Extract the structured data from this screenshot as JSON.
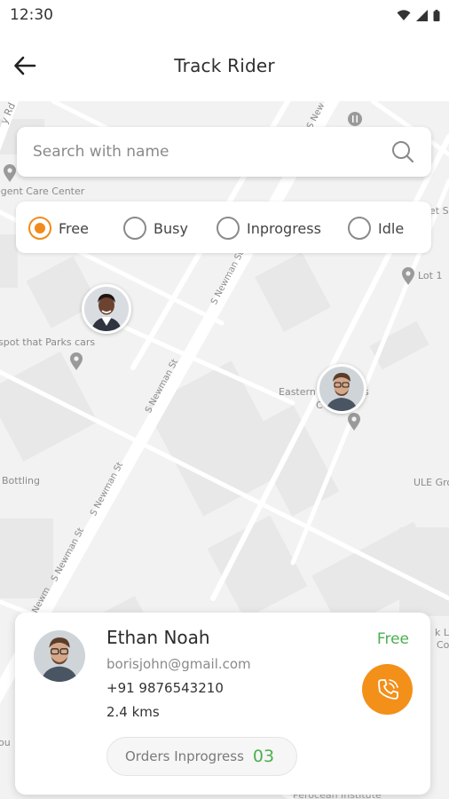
{
  "status_bar": {
    "time": "12:30"
  },
  "header": {
    "title": "Track Rider"
  },
  "search": {
    "placeholder": "Search with name"
  },
  "filters": [
    {
      "label": "Free",
      "selected": true
    },
    {
      "label": "Busy",
      "selected": false
    },
    {
      "label": "Inprogress",
      "selected": false
    },
    {
      "label": "Idle",
      "selected": false
    }
  ],
  "map": {
    "labels": {
      "rd": "y Rd",
      "care_center": "egent Care Center",
      "spot_parks": "spot that Parks cars",
      "eastern": "Eastern",
      "eastern_right": "s",
      "eastern_sub": "C",
      "bottling": "Bottling",
      "ule": "ULE Gro",
      "lot": "Lot 1",
      "st_right": "et S",
      "newman_1": "S Newman St",
      "newman_2": "S Newman St",
      "newman_3": "S Newman St",
      "newman_4": "S Newman St",
      "newman_5": "S Newm",
      "newman_top": "S New",
      "lar": "k Lar",
      "cor": "Co",
      "ou": "ou",
      "bottom": "Perocean Institute"
    }
  },
  "rider": {
    "name": "Ethan Noah",
    "status": "Free",
    "email": "borisjohn@gmail.com",
    "phone": "+91 9876543210",
    "distance": "2.4 kms",
    "orders_label": "Orders Inprogress",
    "orders_count": "03"
  },
  "colors": {
    "accent": "#f39019",
    "success": "#4caf50",
    "map_bg": "#f2f2f2"
  },
  "icons": {
    "back": "arrow-left-icon",
    "search": "search-icon",
    "call": "phone-call-icon",
    "wifi": "wifi-icon",
    "signal": "signal-icon",
    "battery": "battery-icon"
  }
}
